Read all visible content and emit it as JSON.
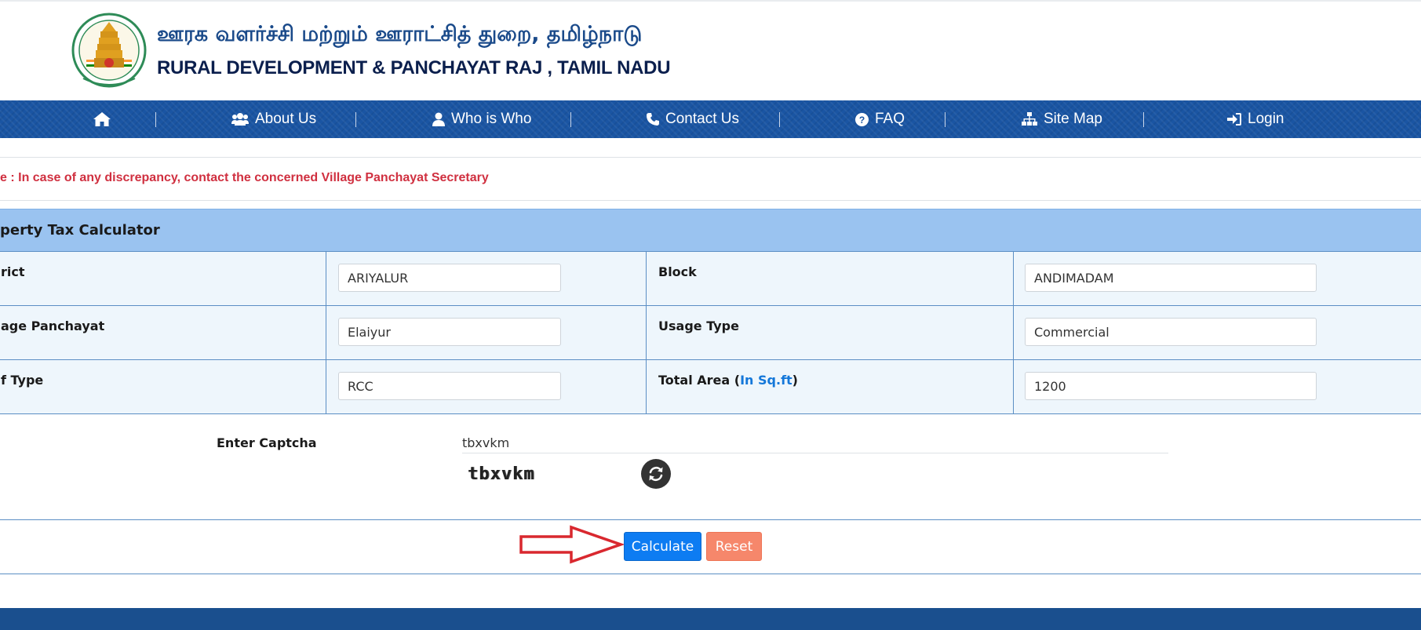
{
  "header": {
    "title_tamil": "ஊரக வளர்ச்சி மற்றும் ஊராட்சித் துறை, தமிழ்நாடு",
    "title_english": "RURAL DEVELOPMENT & PANCHAYAT RAJ , TAMIL NADU"
  },
  "nav": {
    "items": [
      {
        "label": "",
        "icon": "home-icon"
      },
      {
        "label": "About Us",
        "icon": "users-icon"
      },
      {
        "label": "Who is Who",
        "icon": "user-icon"
      },
      {
        "label": "Contact Us",
        "icon": "phone-icon"
      },
      {
        "label": "FAQ",
        "icon": "question-circle-icon"
      },
      {
        "label": "Site Map",
        "icon": "sitemap-icon"
      },
      {
        "label": "Login",
        "icon": "sign-in-icon"
      }
    ]
  },
  "notice": "e : In case of any discrepancy, contact the concerned Village Panchayat Secretary",
  "panel": {
    "title": "perty Tax Calculator"
  },
  "form": {
    "rows": [
      {
        "left_label": "rict",
        "left_value": "ARIYALUR",
        "right_label": "Block",
        "right_value": "ANDIMADAM"
      },
      {
        "left_label": "age Panchayat",
        "left_value": "Elaiyur",
        "right_label": "Usage Type",
        "right_value": "Commercial"
      },
      {
        "left_label": "f Type",
        "left_value": "RCC",
        "right_label_prefix": "Total Area (",
        "right_label_highlight": "In Sq.ft",
        "right_label_suffix": ")",
        "right_value": "1200"
      }
    ]
  },
  "captcha": {
    "label": "Enter Captcha",
    "input_value": "tbxvkm",
    "image_text": "tbxvkm",
    "refresh_icon": "refresh-icon"
  },
  "buttons": {
    "calculate": "Calculate",
    "reset": "Reset"
  },
  "colors": {
    "nav_bg": "#1a55a3",
    "panel_head_bg": "#9ac3f0",
    "notice": "#d03040",
    "calculate_bg": "#0d7cf2",
    "reset_bg": "#f6876b",
    "annotation_arrow": "#d9282f"
  }
}
